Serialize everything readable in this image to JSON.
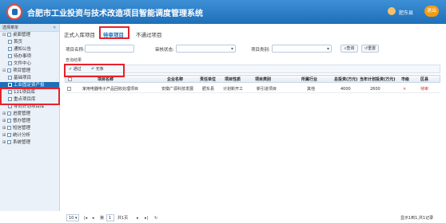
{
  "header": {
    "title": "合肥市工业投资与技术改造项目智能调度管理系统",
    "user_name": "肥东县",
    "exit_label": "退出"
  },
  "sidebar": {
    "header_label": "选择菜单",
    "collapse_glyph": "«",
    "items": [
      {
        "label": "桌面管理",
        "toggle": "⊟"
      },
      {
        "label": "首页"
      },
      {
        "label": "通知公告"
      },
      {
        "label": "待办事项"
      },
      {
        "label": "文件中心"
      },
      {
        "label": "项目管理",
        "toggle": "⊟"
      },
      {
        "label": "基础项目"
      },
      {
        "label": "工业固定资产投"
      },
      {
        "label": "121项目库"
      },
      {
        "label": "重点项目库"
      },
      {
        "label": "导向计划项目库"
      },
      {
        "label": "进度管理",
        "toggle": "⊞"
      },
      {
        "label": "督办管理",
        "toggle": "⊞"
      },
      {
        "label": "短信管理",
        "toggle": "⊞"
      },
      {
        "label": "统计分析",
        "toggle": "⊞"
      },
      {
        "label": "系统管理",
        "toggle": "⊞"
      }
    ]
  },
  "tabs": {
    "items": [
      "正式入库项目",
      "待审项目",
      "不通过项目"
    ]
  },
  "filters": {
    "project_name_label": "项目名称:",
    "audit_status_label": "审核状态:",
    "project_type_label": "项目类别:",
    "query_label": "查询",
    "reset_label": "重置"
  },
  "results_label": "查询结果",
  "toolbar": {
    "pass_label": "通过",
    "return_label": "无条"
  },
  "table": {
    "columns": [
      "项目名称",
      "企业名称",
      "责任单位",
      "项目性质",
      "项目类别",
      "所属行业",
      "总投资(万元)",
      "当年计划投资(万元)",
      "市级",
      "区县"
    ],
    "rows": [
      [
        "家用电器电子产品回收处理项目",
        "安徽广源科技发展",
        "肥东县",
        "计划新开工",
        "新引进项目",
        "其他",
        "4000",
        "2600",
        "×",
        "待审"
      ]
    ]
  },
  "pager": {
    "page_size": "10",
    "page_prefix": "第",
    "page_value": "1",
    "page_suffix": "共1页",
    "summary": "显示1到1,共1记录"
  },
  "colors": {
    "header_blue": "#1e6fb8",
    "highlight_red": "#e8212b",
    "active_tab": "#1e6fb8"
  }
}
